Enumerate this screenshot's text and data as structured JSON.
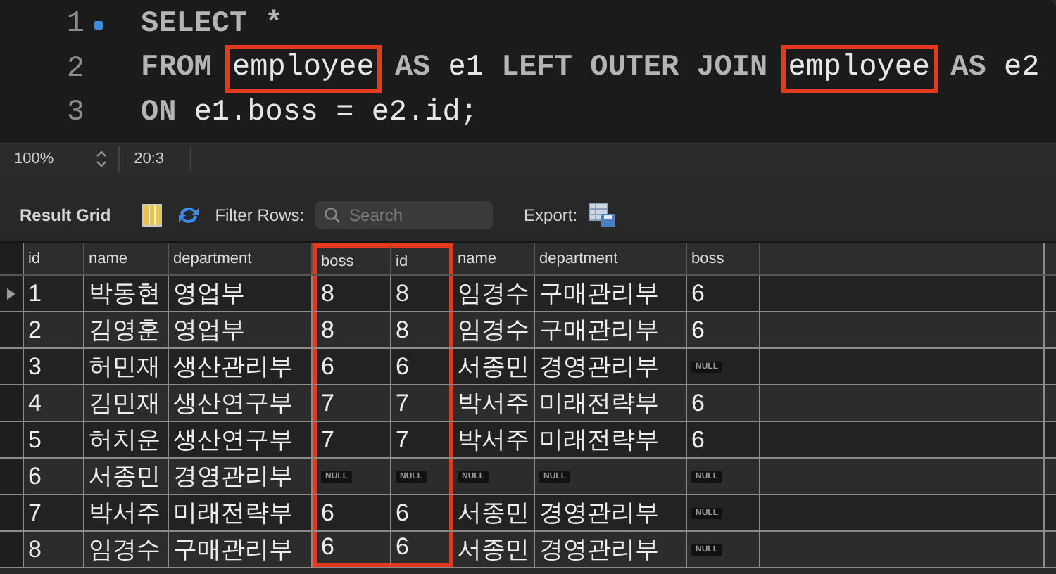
{
  "editor": {
    "lines": [
      {
        "number": "1",
        "marker": true,
        "tokens": [
          {
            "text": "SELECT *",
            "kind": "keyword",
            "highlighted": false
          }
        ]
      },
      {
        "number": "2",
        "tokens": [
          {
            "text": "FROM ",
            "kind": "keyword",
            "highlighted": false
          },
          {
            "text": "employee",
            "kind": "ident",
            "highlighted": true
          },
          {
            "text": " AS ",
            "kind": "keyword",
            "highlighted": false
          },
          {
            "text": "e1 ",
            "kind": "ident",
            "highlighted": false
          },
          {
            "text": "LEFT OUTER JOIN ",
            "kind": "keyword",
            "highlighted": false
          },
          {
            "text": "employee",
            "kind": "ident",
            "highlighted": true
          },
          {
            "text": " AS ",
            "kind": "keyword",
            "highlighted": false
          },
          {
            "text": "e2",
            "kind": "ident",
            "highlighted": false
          }
        ]
      },
      {
        "number": "3",
        "tokens": [
          {
            "text": "ON ",
            "kind": "keyword",
            "highlighted": false
          },
          {
            "text": "e1.boss = e2.id;",
            "kind": "ident",
            "highlighted": false
          }
        ]
      }
    ]
  },
  "status_bar": {
    "zoom": "100%",
    "position": "20:3"
  },
  "toolbar": {
    "title": "Result Grid",
    "filter_label": "Filter Rows:",
    "search": {
      "placeholder": "Search"
    },
    "export_label": "Export:"
  },
  "table": {
    "columns": [
      {
        "label": "id",
        "highlighted": false
      },
      {
        "label": "name",
        "highlighted": false
      },
      {
        "label": "department",
        "highlighted": false
      },
      {
        "label": "boss",
        "highlighted": true
      },
      {
        "label": "id",
        "highlighted": true
      },
      {
        "label": "name",
        "highlighted": false
      },
      {
        "label": "department",
        "highlighted": false
      },
      {
        "label": "boss",
        "highlighted": false
      }
    ],
    "rows": [
      {
        "selected": true,
        "cells": [
          "1",
          "박동현",
          "영업부",
          "8",
          "8",
          "임경수",
          "구매관리부",
          "6"
        ]
      },
      {
        "selected": false,
        "cells": [
          "2",
          "김영훈",
          "영업부",
          "8",
          "8",
          "임경수",
          "구매관리부",
          "6"
        ]
      },
      {
        "selected": false,
        "cells": [
          "3",
          "허민재",
          "생산관리부",
          "6",
          "6",
          "서종민",
          "경영관리부",
          {
            "kind": "null",
            "text": "NULL"
          }
        ]
      },
      {
        "selected": false,
        "cells": [
          "4",
          "김민재",
          "생산연구부",
          "7",
          "7",
          "박서주",
          "미래전략부",
          "6"
        ]
      },
      {
        "selected": false,
        "cells": [
          "5",
          "허치운",
          "생산연구부",
          "7",
          "7",
          "박서주",
          "미래전략부",
          "6"
        ]
      },
      {
        "selected": false,
        "cells": [
          "6",
          "서종민",
          "경영관리부",
          {
            "kind": "null",
            "text": "NULL"
          },
          {
            "kind": "null",
            "text": "NULL"
          },
          {
            "kind": "null",
            "text": "NULL"
          },
          {
            "kind": "null",
            "text": "NULL"
          },
          {
            "kind": "null",
            "text": "NULL"
          }
        ]
      },
      {
        "selected": false,
        "cells": [
          "7",
          "박서주",
          "미래전략부",
          "6",
          "6",
          "서종민",
          "경영관리부",
          {
            "kind": "null",
            "text": "NULL"
          }
        ]
      },
      {
        "selected": false,
        "cells": [
          "8",
          "임경수",
          "구매관리부",
          "6",
          "6",
          "서종민",
          "경영관리부",
          {
            "kind": "null",
            "text": "NULL"
          }
        ]
      }
    ]
  }
}
